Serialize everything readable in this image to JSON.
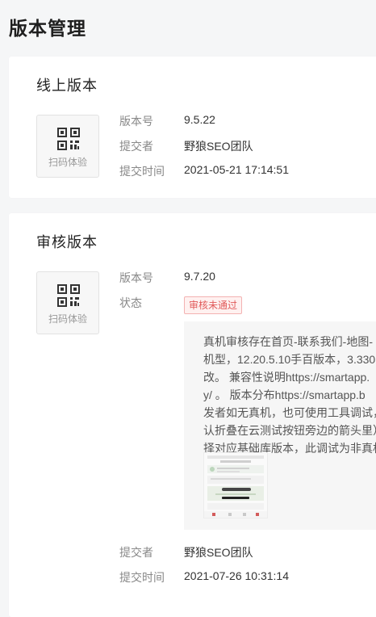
{
  "page": {
    "title": "版本管理"
  },
  "online": {
    "title": "线上版本",
    "qr_label": "扫码体验",
    "version_label": "版本号",
    "version": "9.5.22",
    "submitter_label": "提交者",
    "submitter": "野狼SEO团队",
    "time_label": "提交时间",
    "time": "2021-05-21 17:14:51"
  },
  "review": {
    "title": "审核版本",
    "qr_label": "扫码体验",
    "version_label": "版本号",
    "version": "9.7.20",
    "status_label": "状态",
    "status": "审核未通过",
    "reason_lines": [
      "真机审核存在首页-联系我们-地图-",
      "机型，12.20.5.10手百版本，3.330",
      "改。 兼容性说明https://smartapp.",
      "y/ 。 版本分布https://smartapp.b",
      "发者如无真机，也可使用工具调试，",
      "认折叠在云测试按钮旁边的箭头里）",
      "择对应基础库版本，此调试为非真机"
    ],
    "submitter_label": "提交者",
    "submitter": "野狼SEO团队",
    "time_label": "提交时间",
    "time": "2021-07-26 10:31:14"
  },
  "colors": {
    "accent_error": "#e15a5a",
    "badge_bg": "#fff1f0",
    "page_bg": "#f5f6f7"
  }
}
